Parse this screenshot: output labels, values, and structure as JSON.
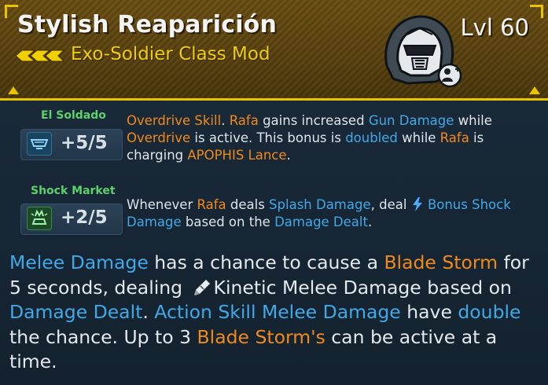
{
  "item": {
    "name": "Stylish Reaparición",
    "type": "Exo-Soldier Class Mod",
    "level": "Lvl 60",
    "rarity_color": "#e8c400",
    "helmet_icon": "exo-soldier-helmet-icon",
    "rarity_icon": "legendary-chevrons-icon"
  },
  "skills": [
    {
      "name": "El Soldado",
      "points": "+5/5",
      "icon": "el-soldado-skill-icon",
      "desc": {
        "s1": "Overdrive Skill",
        "s2": ". ",
        "s3": "Rafa",
        "s4": " gains increased ",
        "s5": "Gun Damage",
        "s6": " while ",
        "s7": "Overdrive",
        "s8": " is active. This bonus is ",
        "s9": "doubled",
        "s10": " while ",
        "s11": "Rafa",
        "s12": " is charging ",
        "s13": "APOPHIS Lance",
        "s14": "."
      }
    },
    {
      "name": "Shock Market",
      "points": "+2/5",
      "icon": "shock-market-skill-icon",
      "desc": {
        "s1": "Whenever ",
        "s2": "Rafa",
        "s3": " deals ",
        "s4": "Splash Damage",
        "s5": ", deal ",
        "s6": "Bonus Shock Damage",
        "s7": " based on the ",
        "s8": "Damage Dealt",
        "s9": "."
      }
    }
  ],
  "effect": {
    "s1": "Melee Damage",
    "s2": " has a chance to cause a ",
    "s3": "Blade Storm",
    "s4": " for 5 seconds, dealing ",
    "s5": "Kinetic Melee Damage",
    "s6": " based on ",
    "s7": "Damage Dealt",
    "s8": ". ",
    "s9": "Action Skill Melee Damage",
    "s10": " have ",
    "s11": "double",
    "s12": " the chance. Up to 3 ",
    "s13": "Blade Storm's",
    "s14": " can be active at a time."
  },
  "colors": {
    "keyword_orange": "#f08a1c",
    "keyword_blue": "#43a8e6",
    "skill_name_green": "#5ed06c",
    "header_gold": "#e8c400"
  }
}
